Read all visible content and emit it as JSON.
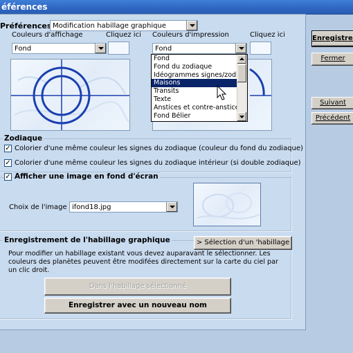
{
  "window": {
    "title": "éférences"
  },
  "prefs": {
    "label": "Préférences :",
    "selected": "Modification habillage graphique"
  },
  "affichage": {
    "label": "Couleurs d'affichage",
    "click_label": "Cliquez ici",
    "selected": "Fond"
  },
  "impression": {
    "label": "Couleurs d'impression",
    "click_label": "Cliquez ici",
    "selected": "Fond",
    "options": [
      "Fond",
      "Fond du zodiaque",
      "Idéogrammes signes/zodiac",
      "Maisons",
      "Transits",
      "Texte",
      "Anstices et contre-anstices",
      "Fond Bélier"
    ],
    "selected_index": 3
  },
  "zodiaque": {
    "title": "Zodiaque",
    "check1": "Colorier d'une même couleur les signes du zodiaque (couleur du fond du zodiaque)",
    "check2": "Colorier d'une même couleur les signes du zodiaque intérieur (si double zodiaque)"
  },
  "image": {
    "title": "Afficher une image en fond d'écran",
    "choice_label": "Choix de l'image",
    "file": "ifond18.jpg"
  },
  "enregistrement": {
    "title": "Enregistrement de l'habillage graphique",
    "select_button": "> Sélection d'un 'habillage",
    "description": "Pour modifier un habillage existant vous devez auparavant le sélectionner. Les couleurs des planètes peuvent être modifées directement sur la carte du ciel par un clic droit.",
    "save_selected": "Dans l'habillage sélectionné",
    "save_new": "Enregistrer avec un nouveau nom"
  },
  "side": {
    "save": "Enregistrer",
    "close": "Fermer",
    "next": "Suivant",
    "prev": "Précédent"
  }
}
